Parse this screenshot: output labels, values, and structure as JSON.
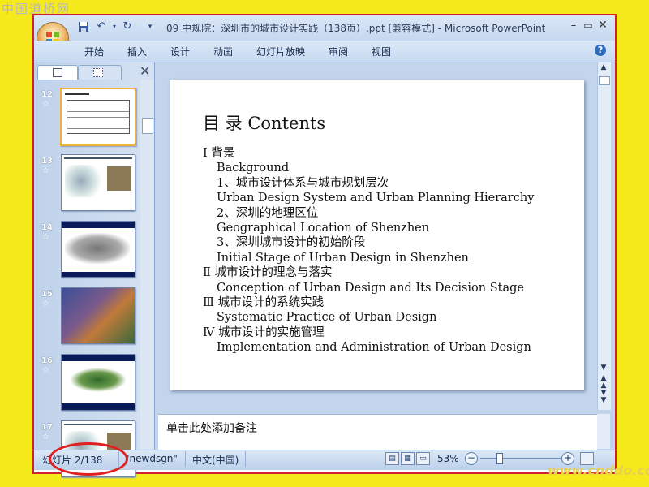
{
  "watermark_top": "中国道桥网",
  "window": {
    "title": "09 中规院：深圳市的城市设计实践（138页）.ppt [兼容模式] - Microsoft PowerPoint"
  },
  "ribbon_tabs": [
    "开始",
    "插入",
    "设计",
    "动画",
    "幻灯片放映",
    "审阅",
    "视图"
  ],
  "thumbnails": [
    {
      "num": "12",
      "selected": true,
      "style": "table"
    },
    {
      "num": "13",
      "selected": false,
      "style": "map-white"
    },
    {
      "num": "14",
      "selected": false,
      "style": "map-bar"
    },
    {
      "num": "15",
      "selected": false,
      "style": "map-color"
    },
    {
      "num": "16",
      "selected": false,
      "style": "map-green"
    },
    {
      "num": "17",
      "selected": false,
      "style": "map-white"
    }
  ],
  "slide": {
    "title": "目    录 Contents",
    "lines": [
      {
        "text": "Ⅰ 背景",
        "indent": 0
      },
      {
        "text": "Background",
        "indent": 1
      },
      {
        "text": "1、城市设计体系与城市规划层次",
        "indent": 1
      },
      {
        "text": "Urban Design System and Urban Planning Hierarchy",
        "indent": 1
      },
      {
        "text": "2、深圳的地理区位",
        "indent": 1
      },
      {
        "text": "Geographical Location of Shenzhen",
        "indent": 1
      },
      {
        "text": "3、深圳城市设计的初始阶段",
        "indent": 1
      },
      {
        "text": " Initial Stage of Urban Design in Shenzhen",
        "indent": 1
      },
      {
        "text": "Ⅱ 城市设计的理念与落实",
        "indent": 0
      },
      {
        "text": "Conception of Urban Design and Its Decision Stage",
        "indent": 1
      },
      {
        "text": "Ⅲ 城市设计的系统实践",
        "indent": 0
      },
      {
        "text": "Systematic Practice of Urban Design",
        "indent": 1
      },
      {
        "text": "Ⅳ 城市设计的实施管理",
        "indent": 0
      },
      {
        "text": "Implementation and Administration of Urban Design",
        "indent": 1
      }
    ]
  },
  "notes_placeholder": "单击此处添加备注",
  "status": {
    "slide_counter": "幻灯片 2/138",
    "theme": "\"newdsgn\"",
    "language": "中文(中国)",
    "zoom": "53%"
  },
  "watermark_bottom": "www.cnddo.com",
  "colors": {
    "frame_border": "#d0212c",
    "highlight_ellipse": "#e02020",
    "background": "#f6ea1c"
  }
}
